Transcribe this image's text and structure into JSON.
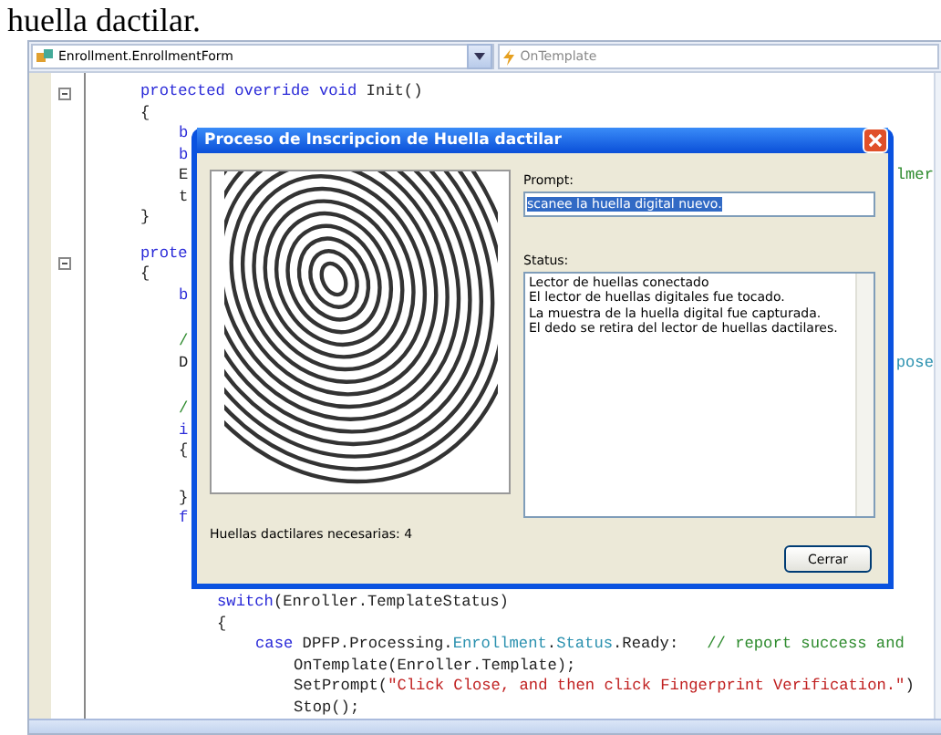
{
  "heading": "huella dactilar.",
  "toolbar": {
    "class_combo": "Enrollment.EnrollmentForm",
    "member_combo": "OnTemplate"
  },
  "code": [
    {
      "segments": [
        {
          "kind": "keyword",
          "text": "protected override void"
        },
        {
          "kind": "plain",
          "text": " Init()"
        }
      ]
    },
    {
      "segments": [
        {
          "kind": "plain",
          "text": "{"
        }
      ],
      "children": [
        {
          "segments": [
            {
              "kind": "keyword",
              "text": "b"
            }
          ]
        },
        {
          "segments": [
            {
              "kind": "keyword",
              "text": "b"
            }
          ]
        },
        {
          "segments": [
            {
              "kind": "plain",
              "text": "E"
            }
          ],
          "right": {
            "kind": "comment",
            "text": "lmer"
          }
        },
        {
          "segments": [
            {
              "kind": "plain",
              "text": "t"
            }
          ]
        }
      ]
    },
    {
      "segments": [
        {
          "kind": "plain",
          "text": "}"
        }
      ]
    },
    {
      "gap_before": true,
      "segments": [
        {
          "kind": "keyword",
          "text": "prote"
        }
      ]
    },
    {
      "segments": [
        {
          "kind": "plain",
          "text": "{"
        }
      ],
      "children": [
        {
          "segments": [
            {
              "kind": "keyword",
              "text": "b"
            }
          ]
        },
        {
          "gap_before": true,
          "segments": [
            {
              "kind": "comment",
              "text": "/"
            }
          ]
        },
        {
          "segments": [
            {
              "kind": "plain",
              "text": "D"
            }
          ],
          "right": {
            "kind": "type",
            "text": "pose"
          }
        },
        {
          "gap_before": true,
          "segments": [
            {
              "kind": "comment",
              "text": "/"
            }
          ]
        },
        {
          "segments": [
            {
              "kind": "keyword",
              "text": "i"
            }
          ]
        },
        {
          "segments": [
            {
              "kind": "plain",
              "text": "{"
            }
          ]
        },
        {
          "gap_before": true,
          "segments": [
            {
              "kind": "plain",
              "text": "}"
            }
          ]
        },
        {
          "segments": [
            {
              "kind": "keyword",
              "text": "f"
            }
          ],
          "children": [
            {
              "gap_before": true,
              "segments": [
                {
                  "kind": "keyword",
                  "text": "switch"
                },
                {
                  "kind": "plain",
                  "text": "(Enroller.TemplateStatus)"
                }
              ]
            },
            {
              "segments": [
                {
                  "kind": "plain",
                  "text": "{"
                }
              ],
              "children": [
                {
                  "segments": [
                    {
                      "kind": "keyword",
                      "text": "case"
                    },
                    {
                      "kind": "plain",
                      "text": " DPFP.Processing."
                    },
                    {
                      "kind": "type",
                      "text": "Enrollment"
                    },
                    {
                      "kind": "plain",
                      "text": "."
                    },
                    {
                      "kind": "type",
                      "text": "Status"
                    },
                    {
                      "kind": "plain",
                      "text": ".Ready:   "
                    },
                    {
                      "kind": "comment",
                      "text": "// report success and"
                    }
                  ],
                  "children": [
                    {
                      "segments": [
                        {
                          "kind": "plain",
                          "text": "OnTemplate(Enroller.Template);"
                        }
                      ]
                    },
                    {
                      "segments": [
                        {
                          "kind": "plain",
                          "text": "SetPrompt("
                        },
                        {
                          "kind": "string",
                          "text": "\"Click Close, and then click Fingerprint Verification.\""
                        },
                        {
                          "kind": "plain",
                          "text": ")"
                        }
                      ]
                    },
                    {
                      "segments": [
                        {
                          "kind": "plain",
                          "text": "Stop();"
                        }
                      ]
                    }
                  ]
                }
              ]
            }
          ]
        }
      ]
    }
  ],
  "dialog": {
    "title": "Proceso de Inscripcion de Huella dactilar",
    "prompt": {
      "label": "Prompt:",
      "value": "scanee la huella digital nuevo.",
      "selected": true
    },
    "status": {
      "label": "Status:",
      "lines": [
        "Lector de huellas conectado",
        "El lector de huellas digitales fue tocado.",
        "La muestra de la huella digital fue capturada.",
        "El dedo se retira del lector de huellas dactilares."
      ]
    },
    "samples_needed": "Huellas dactilares necesarias: 4",
    "close_button": "Cerrar"
  }
}
